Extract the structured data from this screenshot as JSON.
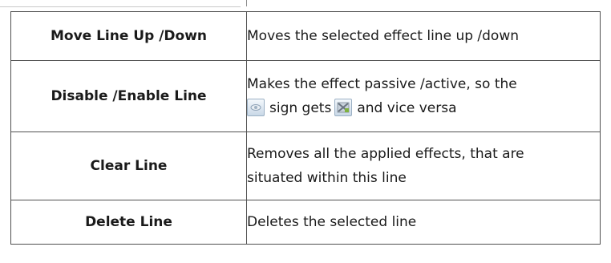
{
  "rows": [
    {
      "command": "Move Line Up /Down",
      "description": "Moves the selected effect line up /down"
    },
    {
      "command": "Disable /Enable Line",
      "description_line1": "Makes the effect passive /active, so the",
      "description_pre_icon": "sign gets",
      "description_post_icon": "and vice versa",
      "icons": [
        "eye-icon",
        "crossed-effect-icon"
      ]
    },
    {
      "command": "Clear Line",
      "description_line1": "Removes all the applied effects, that are",
      "description_line2": "situated within this line"
    },
    {
      "command": "Delete Line",
      "description": "Deletes the selected line"
    }
  ]
}
